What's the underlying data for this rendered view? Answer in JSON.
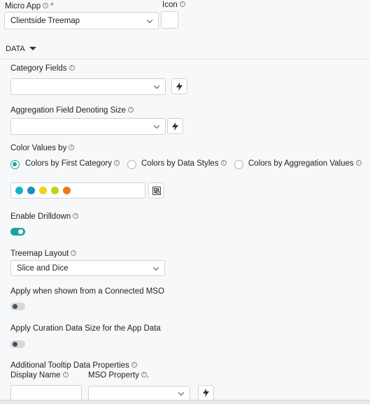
{
  "micro_app": {
    "label": "Micro App",
    "required": "*",
    "value": "Clientside Treemap"
  },
  "icon_field": {
    "label": "Icon"
  },
  "data_section": {
    "label": "DATA"
  },
  "category_fields": {
    "label": "Category Fields",
    "value": ""
  },
  "aggregation_field": {
    "label": "Aggregation Field Denoting Size",
    "value": ""
  },
  "color_values": {
    "label": "Color Values by",
    "options": [
      {
        "label": "Colors by First Category",
        "selected": true
      },
      {
        "label": "Colors by Data Styles",
        "selected": false
      },
      {
        "label": "Colors by Aggregation Values",
        "selected": false
      }
    ],
    "palette": [
      "#1ab0c2",
      "#1d8fc5",
      "#f3d21a",
      "#b7d61c",
      "#ea7a1e"
    ]
  },
  "drilldown": {
    "label": "Enable Drilldown",
    "enabled": true
  },
  "treemap_layout": {
    "label": "Treemap Layout",
    "value": "Slice and Dice"
  },
  "connected_mso": {
    "label": "Apply when shown from a Connected MSO",
    "enabled": false
  },
  "curation_size": {
    "label": "Apply Curation Data Size for the App Data",
    "enabled": false
  },
  "tooltip": {
    "label": "Additional Tooltip Data Properties",
    "display_name_label": "Display Name",
    "mso_property_label": "MSO Property",
    "mso_suffix": "."
  },
  "colors": {
    "accent": "#1aa39a"
  }
}
